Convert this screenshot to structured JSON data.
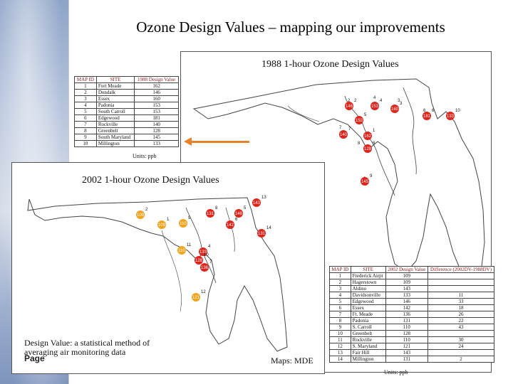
{
  "title": "Ozone Design Values – mapping our improvements",
  "panel1988": {
    "heading": "1988 1-hour Ozone Design Values",
    "units": "Units: ppb",
    "headers": [
      "MAP ID",
      "SITE",
      "1988 Design Value"
    ],
    "rows": [
      [
        "1",
        "Fort Meade",
        "162"
      ],
      [
        "2",
        "Dundalk",
        "146"
      ],
      [
        "3",
        "Essex",
        "160"
      ],
      [
        "4",
        "Padonia",
        "153"
      ],
      [
        "5",
        "South Carroll",
        "153"
      ],
      [
        "6",
        "Edgewood",
        "181"
      ],
      [
        "7",
        "Rockville",
        "140"
      ],
      [
        "8",
        "Greenbelt",
        "128"
      ],
      [
        "9",
        "South Maryland",
        "145"
      ],
      [
        "10",
        "Millington",
        "133"
      ]
    ],
    "markers": [
      {
        "id": "1",
        "value": "162"
      },
      {
        "id": "2",
        "value": "146"
      },
      {
        "id": "3",
        "value": "160"
      },
      {
        "id": "4",
        "value": "153"
      },
      {
        "id": "5",
        "value": "153"
      },
      {
        "id": "6",
        "value": "181"
      },
      {
        "id": "7",
        "value": "140"
      },
      {
        "id": "8",
        "value": "128"
      },
      {
        "id": "9",
        "value": "145"
      },
      {
        "id": "10",
        "value": "133"
      }
    ]
  },
  "panel2002": {
    "heading": "2002 1-hour Ozone Design Values",
    "units": "Units: ppb",
    "headers": [
      "MAP ID",
      "SITE",
      "2002 Design Value",
      "Difference (2002DV-1988DV)"
    ],
    "rows": [
      [
        "1",
        "Frederick Airpt",
        "109",
        ""
      ],
      [
        "2",
        "Hagerstown",
        "109",
        ""
      ],
      [
        "3",
        "Aldino",
        "143",
        ""
      ],
      [
        "4",
        "Davidsonville",
        "133",
        "11"
      ],
      [
        "5",
        "Edgewood",
        "146",
        "33"
      ],
      [
        "6",
        "Essex",
        "142",
        "18"
      ],
      [
        "7",
        "Ft. Meade",
        "136",
        "26"
      ],
      [
        "8",
        "Padonia",
        "131",
        "22"
      ],
      [
        "9",
        "S. Carroll",
        "110",
        "43"
      ],
      [
        "10",
        "Greenbelt",
        "128",
        ""
      ],
      [
        "11",
        "Rockville",
        "110",
        "30"
      ],
      [
        "12",
        "S. Maryland",
        "121",
        "24"
      ],
      [
        "13",
        "Fair Hill",
        "143",
        ""
      ],
      [
        "14",
        "Millington",
        "131",
        "2"
      ]
    ],
    "markers": [
      {
        "id": "13",
        "value": "143",
        "status": "red"
      },
      {
        "id": "2",
        "value": "109",
        "status": "orange"
      },
      {
        "id": "1",
        "value": "109",
        "status": "orange"
      },
      {
        "id": "9",
        "value": "110",
        "status": "orange"
      },
      {
        "id": "8",
        "value": "131",
        "status": "red"
      },
      {
        "id": "5",
        "value": "146",
        "status": "red"
      },
      {
        "id": "6",
        "value": "142",
        "status": "red"
      },
      {
        "id": "14",
        "value": "131",
        "status": "red"
      },
      {
        "id": "11",
        "value": "110",
        "status": "orange"
      },
      {
        "id": "4",
        "value": "133",
        "status": "red"
      },
      {
        "id": "10",
        "value": "128",
        "status": "red"
      },
      {
        "id": "7",
        "value": "136",
        "status": "red"
      },
      {
        "id": "12",
        "value": "121",
        "status": "orange"
      }
    ]
  },
  "note": "Design Value: a statistical method of averaging air monitoring data",
  "page_label": "Page",
  "credit": "Maps: MDE",
  "colors": {
    "marker_red": "#e0241b",
    "marker_orange": "#f0a41e",
    "arrow": "#e8822a"
  }
}
